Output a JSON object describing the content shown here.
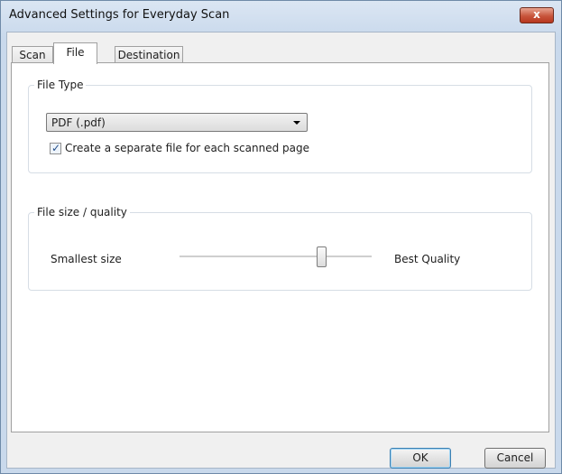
{
  "window": {
    "title": "Advanced Settings for Everyday Scan",
    "close_glyph": "x",
    "accent_color": "#c8553c"
  },
  "tabs": [
    {
      "label": "Scan",
      "active": false
    },
    {
      "label": "File",
      "active": true
    },
    {
      "label": "Destination",
      "active": false
    }
  ],
  "file_type": {
    "group_label": "File Type",
    "selected": "PDF (.pdf)",
    "separate_file_checked": true,
    "separate_file_label": "Create a separate file for each scanned page"
  },
  "quality": {
    "group_label": "File size / quality",
    "min_label": "Smallest size",
    "max_label": "Best Quality",
    "level": 0.74
  },
  "buttons": {
    "ok": "OK",
    "cancel": "Cancel"
  }
}
